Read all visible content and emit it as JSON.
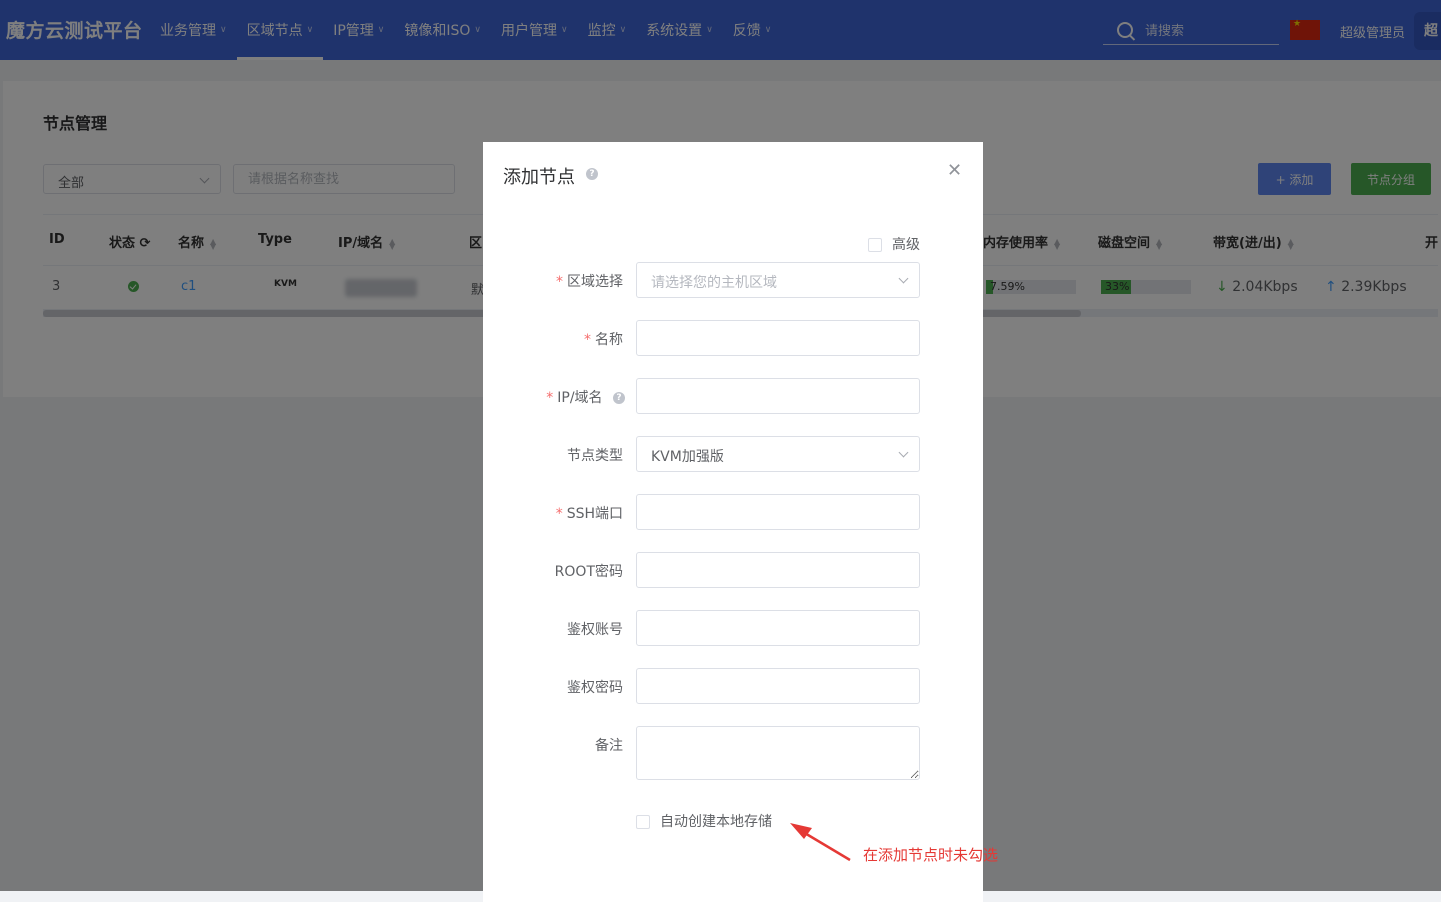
{
  "header": {
    "logo": "魔方云测试平台",
    "nav": [
      {
        "label": "业务管理",
        "active": false
      },
      {
        "label": "区域节点",
        "active": true
      },
      {
        "label": "IP管理",
        "active": false
      },
      {
        "label": "镜像和ISO",
        "active": false
      },
      {
        "label": "用户管理",
        "active": false
      },
      {
        "label": "监控",
        "active": false
      },
      {
        "label": "系统设置",
        "active": false
      },
      {
        "label": "反馈",
        "active": false
      }
    ],
    "search_placeholder": "请搜索",
    "flag_icon": "china-flag-icon",
    "user_name": "超级管理员",
    "avatar_text": "超"
  },
  "page": {
    "title": "节点管理",
    "filter_value": "全部",
    "search_placeholder": "请根据名称查找",
    "add_button": "+ 添加",
    "group_button": "节点分组",
    "columns": {
      "id": "ID",
      "status": "状态",
      "name": "名称",
      "type": "Type",
      "ip": "IP/域名",
      "region": "区",
      "memory": "内存使用率",
      "disk": "磁盘空间",
      "bandwidth": "带宽(进/出)",
      "more": "开"
    },
    "row": {
      "id": "3",
      "status": "online",
      "name": "c1",
      "type": "KVM",
      "region": "默",
      "memory_label": "7.59%",
      "memory_pct": 7.59,
      "disk_label": "33%",
      "disk_pct": 33,
      "bw_in": "2.04Kbps",
      "bw_out": "2.39Kbps"
    }
  },
  "dialog": {
    "title": "添加节点",
    "advanced_label": "高级",
    "fields": {
      "region_label": "区域选择",
      "region_placeholder": "请选择您的主机区域",
      "name_label": "名称",
      "ip_label": "IP/域名",
      "node_type_label": "节点类型",
      "node_type_value": "KVM加强版",
      "ssh_label": "SSH端口",
      "root_label": "ROOT密码",
      "auth_account_label": "鉴权账号",
      "auth_password_label": "鉴权密码",
      "remark_label": "备注"
    },
    "auto_storage_label": "自动创建本地存储"
  },
  "annotation": {
    "text": "在添加节点时未勾选",
    "color": "#e53935"
  },
  "colors": {
    "header_bg": "#3f66d9",
    "primary_button": "#5e87f0",
    "success_button": "#4caf50",
    "required": "#f56c6c"
  }
}
